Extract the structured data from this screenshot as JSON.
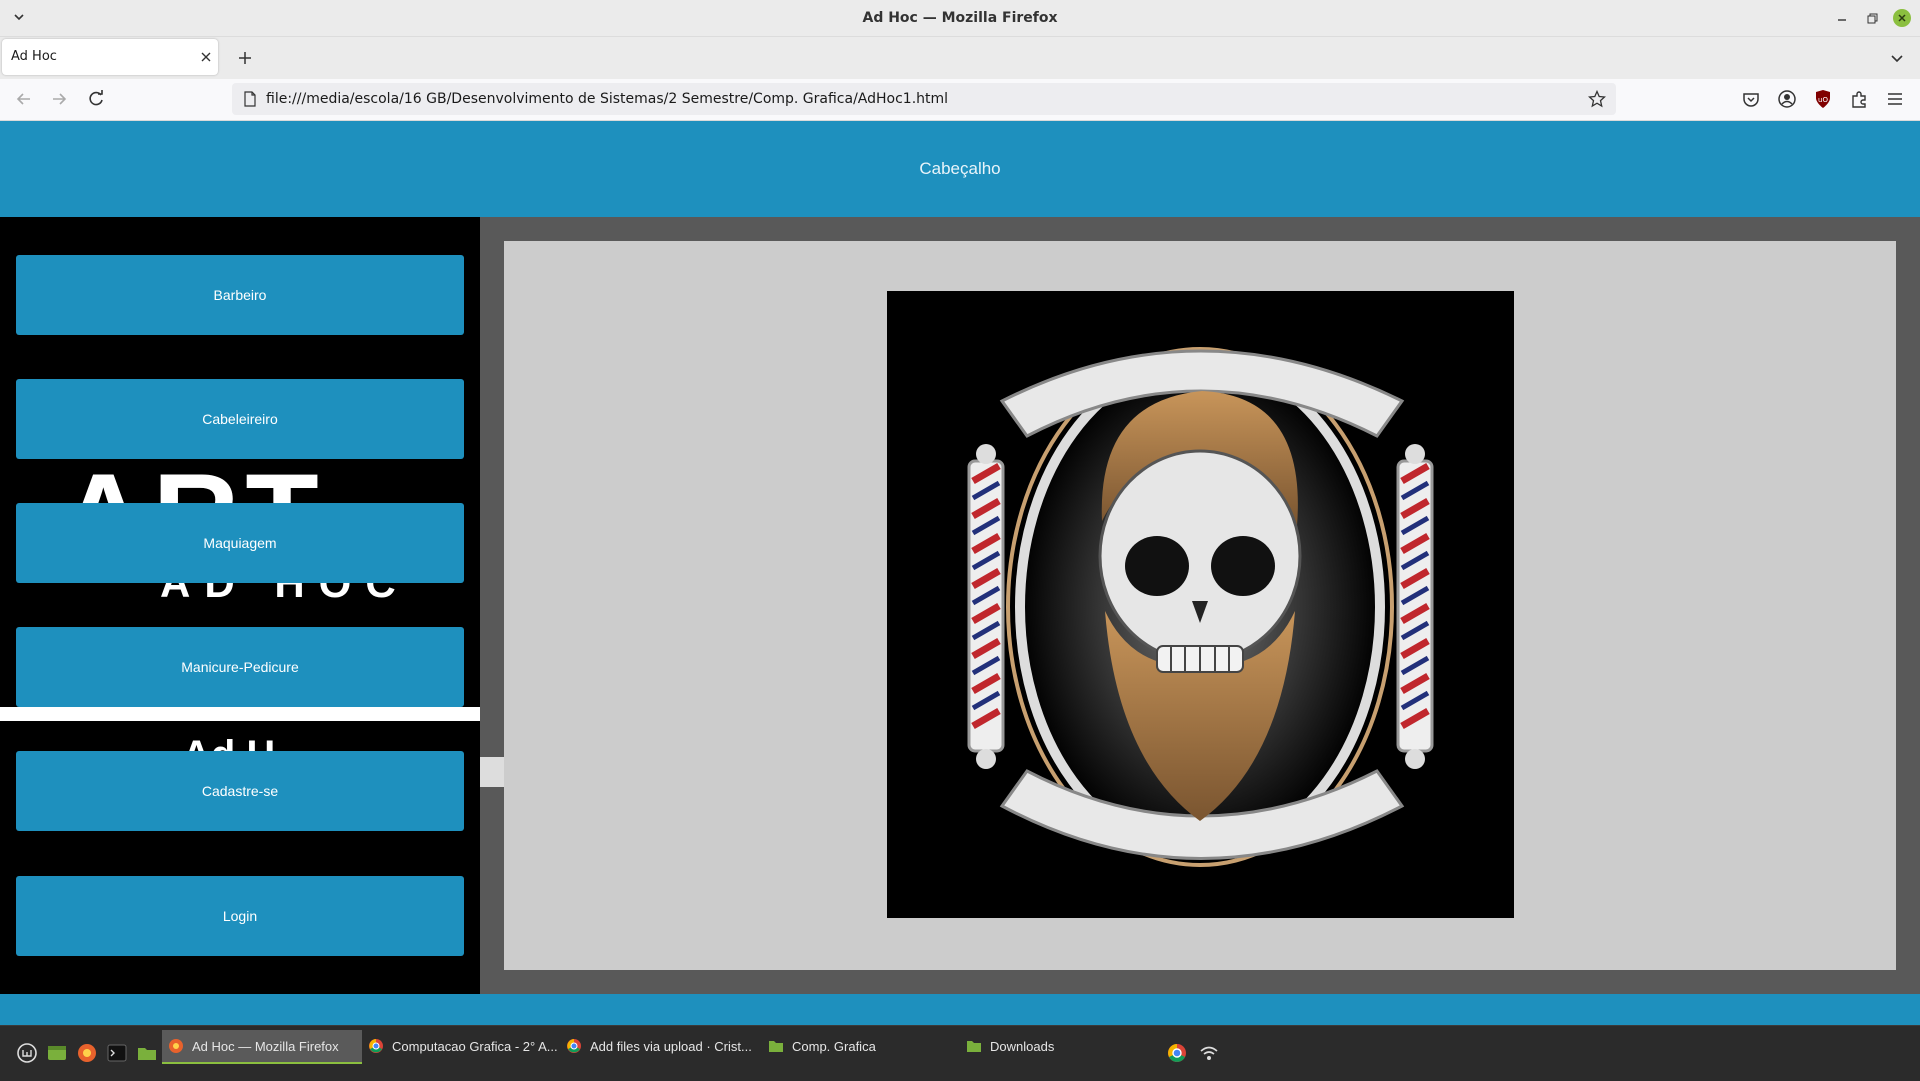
{
  "window": {
    "title": "Ad Hoc — Mozilla Firefox"
  },
  "tabs": [
    {
      "label": "Ad Hoc"
    }
  ],
  "navbar": {
    "url": "file:///media/escola/16 GB/Desenvolvimento de Sistemas/2 Semestre/Comp. Grafica/AdHoc1.html"
  },
  "page": {
    "header": "Cabeçalho",
    "sidebar_background_text": {
      "big": "ART",
      "brand": "AD HOC",
      "small": "Ad H"
    },
    "menu": [
      {
        "label": "Barbeiro"
      },
      {
        "label": "Cabeleireiro"
      },
      {
        "label": "Maquiagem"
      },
      {
        "label": "Manicure-Pedicure"
      },
      {
        "label": "Cadastre-se"
      },
      {
        "label": "Login"
      }
    ]
  },
  "taskbar": {
    "windows": [
      {
        "label": "Ad Hoc — Mozilla Firefox",
        "icon": "firefox-icon"
      },
      {
        "label": "Computacao Grafica - 2° A...",
        "icon": "chrome-icon"
      },
      {
        "label": "Add files via upload · Crist...",
        "icon": "chrome-icon"
      },
      {
        "label": "Comp. Grafica",
        "icon": "folder-icon"
      },
      {
        "label": "Downloads",
        "icon": "folder-icon"
      }
    ]
  },
  "colors": {
    "accent": "#1e90be",
    "sidebar": "#000000",
    "panel": "#cccccc",
    "main_bg": "#595959"
  }
}
